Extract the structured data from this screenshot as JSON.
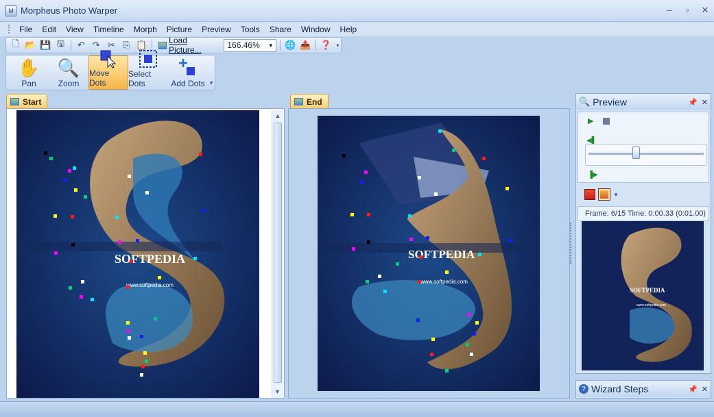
{
  "window": {
    "title": "Morpheus Photo Warper",
    "icon_text": "M"
  },
  "menu": [
    "File",
    "Edit",
    "View",
    "Timeline",
    "Morph",
    "Picture",
    "Preview",
    "Tools",
    "Share",
    "Window",
    "Help"
  ],
  "toolbar": {
    "load_picture": "Load Picture...",
    "zoom_value": "166.46%"
  },
  "tools": [
    {
      "label": "Pan",
      "icon": "hand-icon",
      "active": false
    },
    {
      "label": "Zoom",
      "icon": "magnifier-icon",
      "active": false
    },
    {
      "label": "Move Dots",
      "icon": "cursor-icon",
      "active": true
    },
    {
      "label": "Select Dots",
      "icon": "selection-icon",
      "active": false
    },
    {
      "label": "Add Dots",
      "icon": "add-dot-icon",
      "active": false
    }
  ],
  "tabs": {
    "start": "Start",
    "end": "End"
  },
  "watermark": {
    "brand": "SOFTPEDIA",
    "url": "www.softpedia.com"
  },
  "preview": {
    "title": "Preview",
    "frame_info": "Frame: 6/15 Time: 0:00.33 (0:01.00)",
    "slider_position": 0.4,
    "watermark": "SOFTPEDIA",
    "watermark_url": "www.softpedia.com"
  },
  "wizard": {
    "title": "Wizard Steps"
  },
  "colors": {
    "accent": "#f6b54a",
    "frame": "#bcd3ee",
    "dot_colors": [
      "#ff1a1a",
      "#00d07a",
      "#1a1aff",
      "#ffff00",
      "#ff00ff",
      "#00e5ff",
      "#ffffff",
      "#000000"
    ]
  }
}
